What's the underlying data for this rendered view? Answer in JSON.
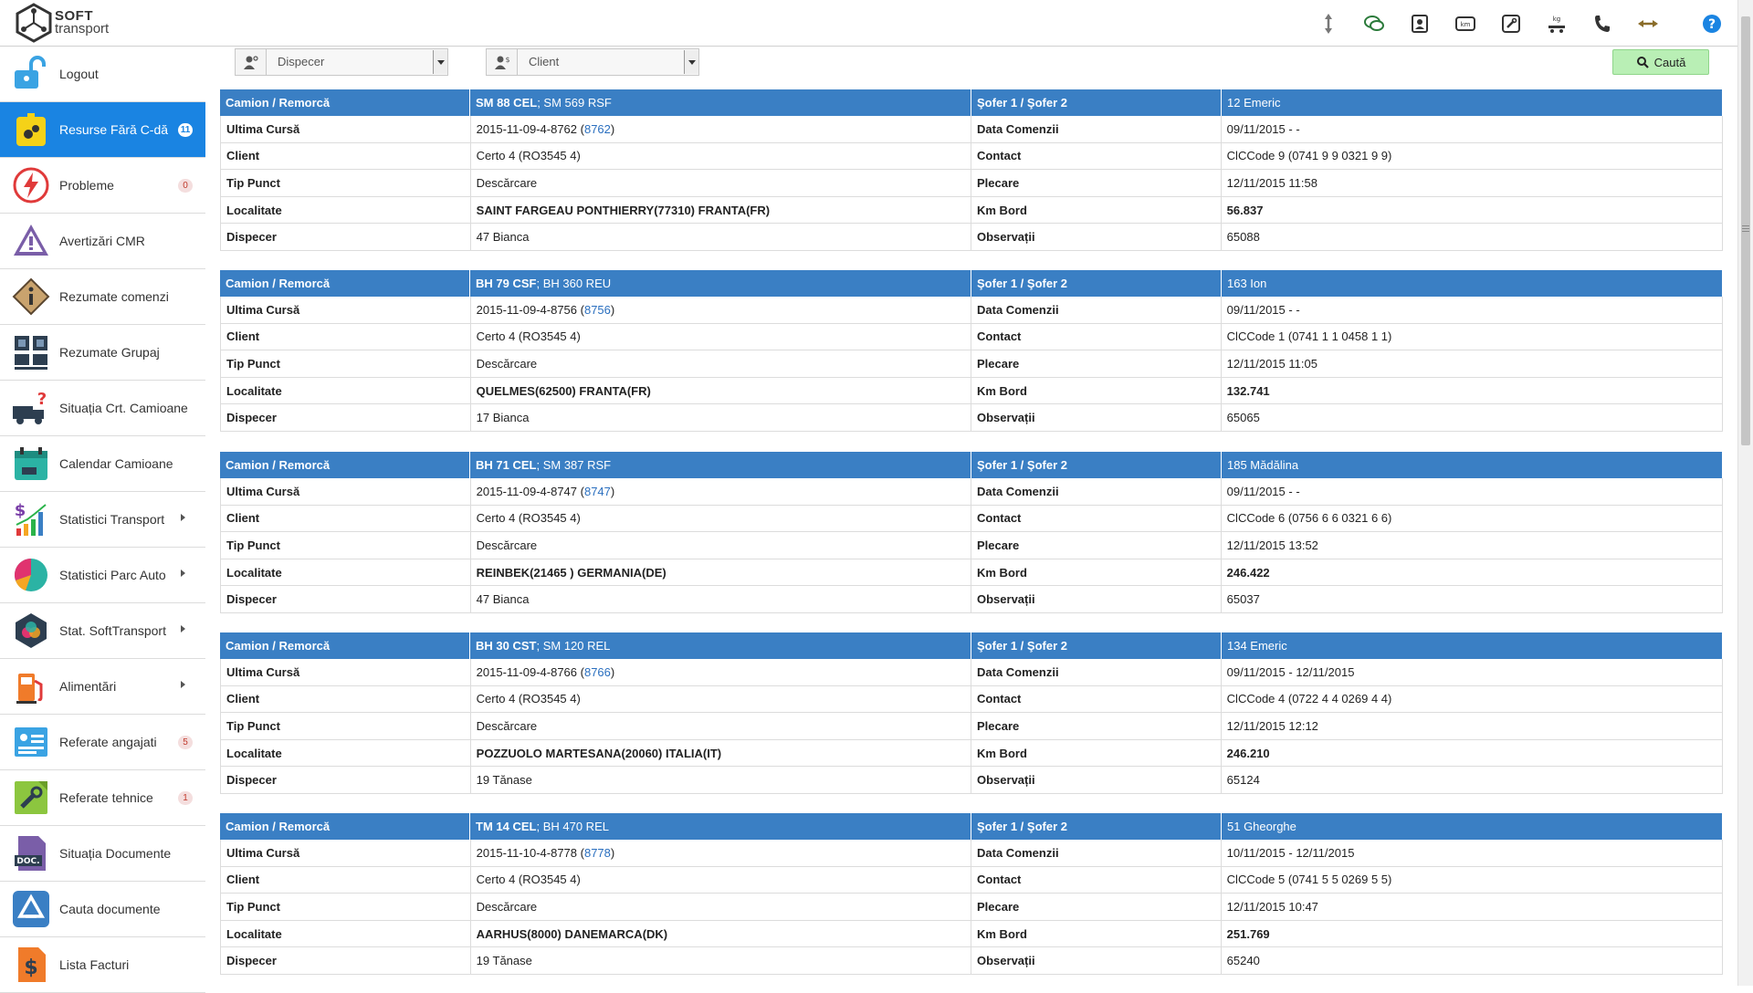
{
  "brand": {
    "soft": "SOFT",
    "transport": "transport"
  },
  "toolbar_icons": [
    "resize-vertical-icon",
    "chat-icon",
    "contact-card-icon",
    "km-icon",
    "wrench-icon",
    "weight-kg-icon",
    "phone-icon",
    "resize-horizontal-icon",
    "help-icon"
  ],
  "sidebar": {
    "items": [
      {
        "label": "Logout",
        "icon": "logout-icon"
      },
      {
        "label": "Resurse Fără C-dă",
        "icon": "resources-icon",
        "badge": "11",
        "active": true
      },
      {
        "label": "Probleme",
        "icon": "problem-icon",
        "badge": "0"
      },
      {
        "label": "Avertizări CMR",
        "icon": "warning-icon"
      },
      {
        "label": "Rezumate comenzi",
        "icon": "info-icon"
      },
      {
        "label": "Rezumate Grupaj",
        "icon": "grupaj-icon"
      },
      {
        "label": "Situația Crt. Camioane",
        "icon": "truck-question-icon"
      },
      {
        "label": "Calendar Camioane",
        "icon": "calendar-icon"
      },
      {
        "label": "Statistici Transport",
        "icon": "stats-icon",
        "submenu": true
      },
      {
        "label": "Statistici Parc Auto",
        "icon": "pie-chart-icon",
        "submenu": true
      },
      {
        "label": "Stat. SoftTransport",
        "icon": "hexagon-icon",
        "submenu": true
      },
      {
        "label": "Alimentări",
        "icon": "fuel-icon",
        "submenu": true
      },
      {
        "label": "Referate angajati",
        "icon": "employee-report-icon",
        "badge": "5"
      },
      {
        "label": "Referate tehnice",
        "icon": "wrench-report-icon",
        "badge": "1"
      },
      {
        "label": "Situația Documente",
        "icon": "doc-icon"
      },
      {
        "label": "Cauta documente",
        "icon": "drive-icon"
      },
      {
        "label": "Lista Facturi",
        "icon": "invoice-icon"
      }
    ]
  },
  "filters": {
    "dispecer": {
      "value": "Dispecer"
    },
    "client": {
      "value": "Client"
    },
    "search_label": "Caută"
  },
  "labels": {
    "camion": "Camion / Remorcă",
    "sofer": "Şofer 1 / Şofer 2",
    "ultima": "Ultima Cursă",
    "data_comenzii": "Data Comenzii",
    "client": "Client",
    "contact": "Contact",
    "tip_punct": "Tip Punct",
    "plecare": "Plecare",
    "localitate": "Localitate",
    "km_bord": "Km Bord",
    "dispecer": "Dispecer",
    "observatii": "Observații"
  },
  "records": [
    {
      "truck": "SM 88 CEL",
      "trailer": "SM 569 RSF",
      "driver": "12 Emeric",
      "curse": "2015-11-09-4-8762",
      "curse_link": "8762",
      "data_comenzii": "09/11/2015 - -",
      "client": "Certo 4 (RO3545 4)",
      "contact": "ClCCode 9 (0741 9 9 0321 9 9)",
      "tip_punct": "Descărcare",
      "plecare": "12/11/2015 11:58",
      "localitate": "SAINT FARGEAU PONTHIERRY(77310) FRANTA(FR)",
      "km_bord": "56.837",
      "dispecer": "47 Bianca",
      "observatii": "65088"
    },
    {
      "truck": "BH 79 CSF",
      "trailer": "BH 360 REU",
      "driver": "163 Ion",
      "curse": "2015-11-09-4-8756",
      "curse_link": "8756",
      "data_comenzii": "09/11/2015 - -",
      "client": "Certo 4 (RO3545 4)",
      "contact": "ClCCode 1 (0741 1 1 0458 1 1)",
      "tip_punct": "Descărcare",
      "plecare": "12/11/2015 11:05",
      "localitate": "QUELMES(62500) FRANTA(FR)",
      "km_bord": "132.741",
      "dispecer": "17 Bianca",
      "observatii": "65065"
    },
    {
      "truck": "BH 71 CEL",
      "trailer": "SM 387 RSF",
      "driver": "185 Mădălina",
      "curse": "2015-11-09-4-8747",
      "curse_link": "8747",
      "data_comenzii": "09/11/2015 - -",
      "client": "Certo 4 (RO3545 4)",
      "contact": "ClCCode 6 (0756 6 6 0321 6 6)",
      "tip_punct": "Descărcare",
      "plecare": "12/11/2015 13:52",
      "localitate": "REINBEK(21465 ) GERMANIA(DE)",
      "km_bord": "246.422",
      "dispecer": "47 Bianca",
      "observatii": "65037"
    },
    {
      "truck": "BH 30 CST",
      "trailer": "SM 120 REL",
      "driver": "134 Emeric",
      "curse": "2015-11-09-4-8766",
      "curse_link": "8766",
      "data_comenzii": "09/11/2015 - 12/11/2015",
      "client": "Certo 4 (RO3545 4)",
      "contact": "ClCCode 4 (0722 4 4 0269 4 4)",
      "tip_punct": "Descărcare",
      "plecare": "12/11/2015 12:12",
      "localitate": "POZZUOLO MARTESANA(20060) ITALIA(IT)",
      "km_bord": "246.210",
      "dispecer": "19 Tănase",
      "observatii": "65124"
    },
    {
      "truck": "TM 14 CEL",
      "trailer": "BH 470 REL",
      "driver": "51 Gheorghe",
      "curse": "2015-11-10-4-8778",
      "curse_link": "8778",
      "data_comenzii": "10/11/2015 - 12/11/2015",
      "client": "Certo 4 (RO3545 4)",
      "contact": "ClCCode 5 (0741 5 5 0269 5 5)",
      "tip_punct": "Descărcare",
      "plecare": "12/11/2015 10:47",
      "localitate": "AARHUS(8000) DANEMARCA(DK)",
      "km_bord": "251.769",
      "dispecer": "19 Tănase",
      "observatii": "65240"
    }
  ]
}
